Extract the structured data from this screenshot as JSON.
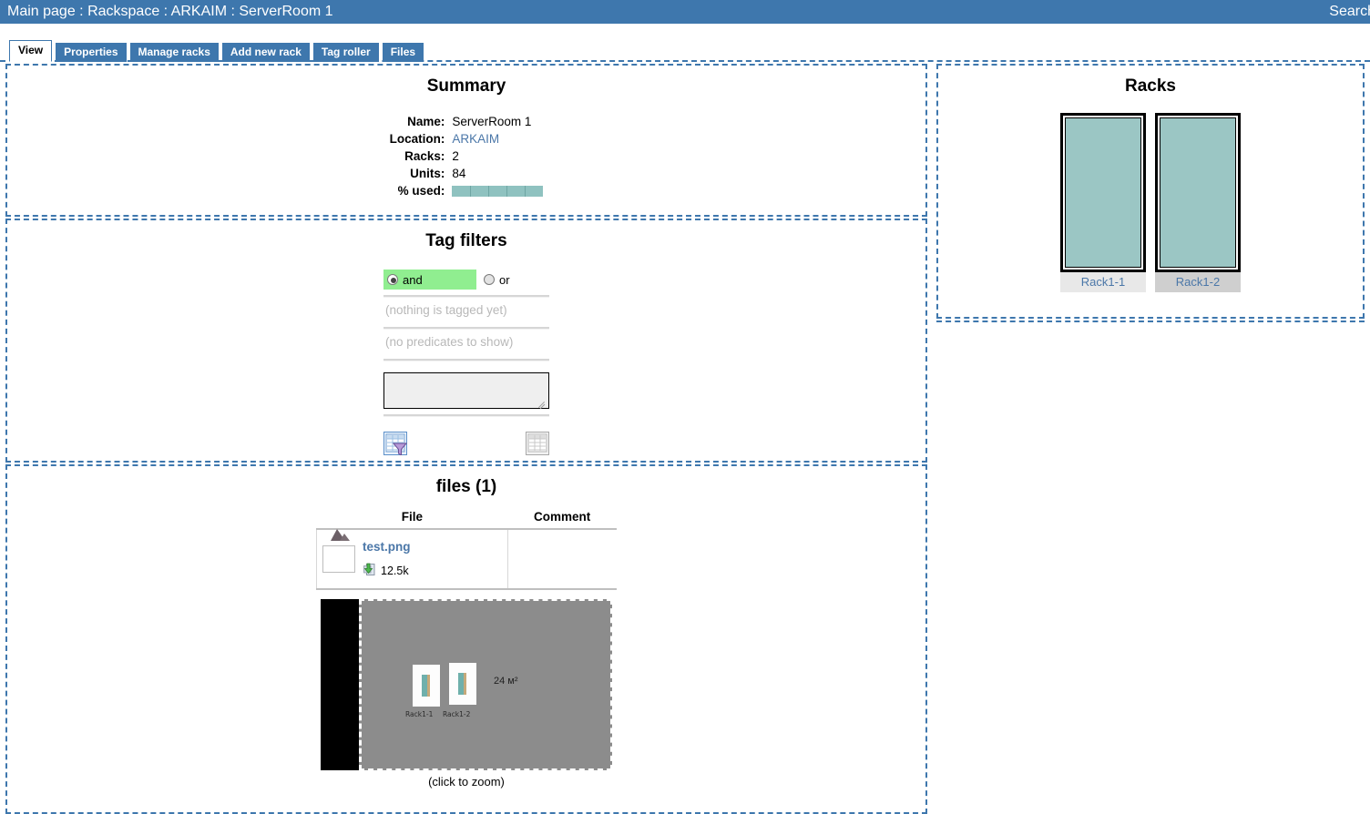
{
  "topbar": {
    "breadcrumb": [
      {
        "label": "Main page",
        "name": "breadcrumb-main-page"
      },
      {
        "label": "Rackspace",
        "name": "breadcrumb-rackspace"
      },
      {
        "label": "ARKAIM",
        "name": "breadcrumb-arkaim"
      },
      {
        "label": "ServerRoom 1",
        "name": "breadcrumb-serverroom-1"
      }
    ],
    "separator": " : ",
    "search_label": "Search",
    "bg_color": "#3e77ad"
  },
  "tabs": [
    {
      "label": "View",
      "active": true
    },
    {
      "label": "Properties",
      "active": false
    },
    {
      "label": "Manage racks",
      "active": false
    },
    {
      "label": "Add new rack",
      "active": false
    },
    {
      "label": "Tag roller",
      "active": false
    },
    {
      "label": "Files",
      "active": false
    }
  ],
  "summary": {
    "title": "Summary",
    "rows": [
      {
        "key": "Name:",
        "value": "ServerRoom 1",
        "link": false
      },
      {
        "key": "Location:",
        "value": "ARKAIM",
        "link": true
      },
      {
        "key": "Racks:",
        "value": "2",
        "link": false
      },
      {
        "key": "Units:",
        "value": "84",
        "link": false
      }
    ],
    "percent_used_label": "% used:",
    "percent_used_value": 100,
    "percent_bar_color": "#8fc2c0"
  },
  "tag_filters": {
    "title": "Tag filters",
    "mode_and": "and",
    "mode_or": "or",
    "mode_selected": "and",
    "and_highlight_color": "#90ee90",
    "nothing_tagged": "(nothing is tagged yet)",
    "no_predicates": "(no predicates to show)",
    "textarea_value": "",
    "textarea_placeholder": "",
    "apply_filter_icon": "apply-filter-icon",
    "reset_filter_icon": "reset-filter-icon"
  },
  "files": {
    "title": "files (1)",
    "columns": [
      "File",
      "Comment"
    ],
    "rows": [
      {
        "filename": "test.png",
        "size": "12.5k",
        "comment": "",
        "thumbnail": "image-thumbnail"
      }
    ]
  },
  "preview": {
    "caption": "(click to zoom)",
    "area_label": "24 м²",
    "racks": [
      {
        "label": "Rack1-1"
      },
      {
        "label": "Rack1-2"
      }
    ]
  },
  "racks_panel": {
    "title": "Racks",
    "racks": [
      {
        "label": "Rack1-1",
        "body_color": "#9bc6c4",
        "label_bg": "#e8e8e8"
      },
      {
        "label": "Rack1-2",
        "body_color": "#9bc6c4",
        "label_bg": "#cfcfcf"
      }
    ]
  }
}
